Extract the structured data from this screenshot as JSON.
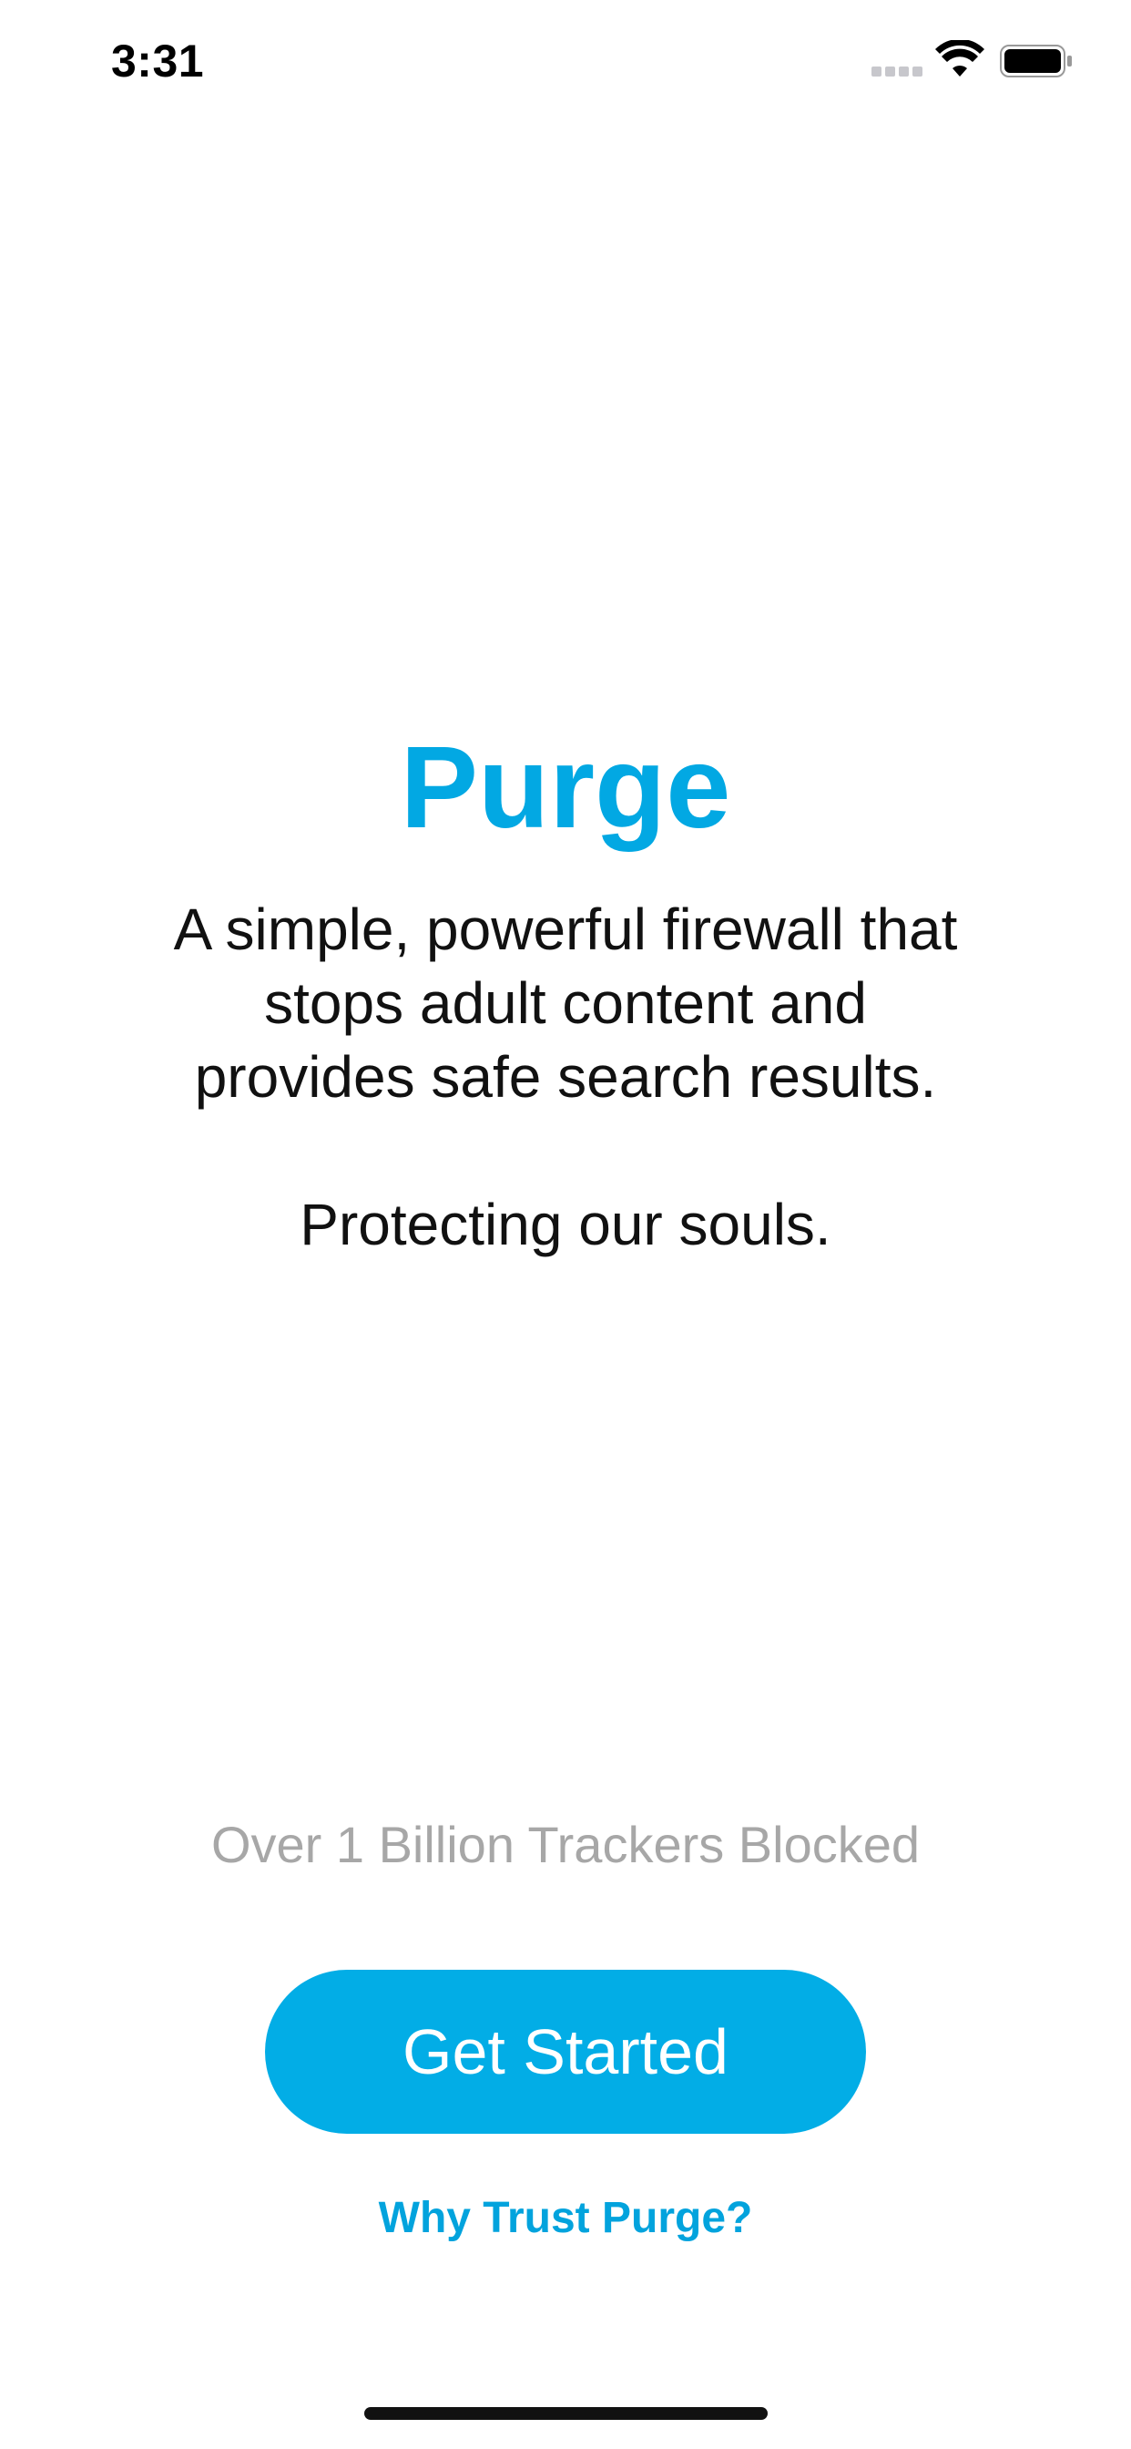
{
  "status_bar": {
    "time": "3:31",
    "icons": [
      "signal-dots-icon",
      "wifi-icon",
      "battery-icon"
    ]
  },
  "main": {
    "title": "Purge",
    "tagline": "A simple, powerful firewall that\nstops adult content and\nprovides safe search results.\n\nProtecting our souls.",
    "trackers_text": "Over 1 Billion Trackers Blocked",
    "get_started_label": "Get Started",
    "why_trust_label": "Why Trust Purge?"
  },
  "colors": {
    "brand_blue": "#02ade6",
    "title_blue": "#02a8e3",
    "muted_gray": "#a7a7a7"
  }
}
